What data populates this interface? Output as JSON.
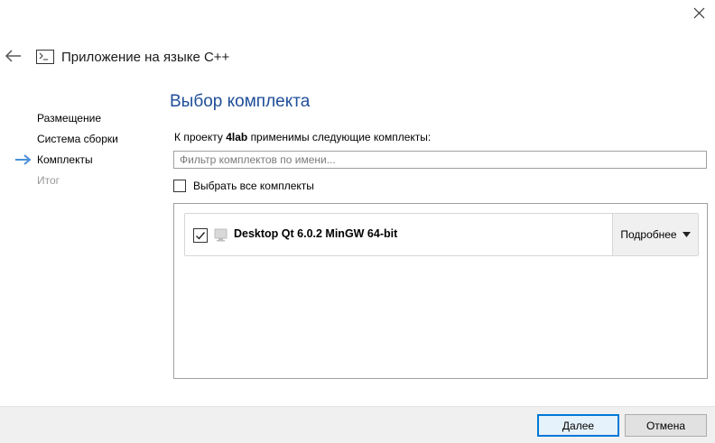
{
  "header": {
    "title": "Приложение на языке C++"
  },
  "steps": [
    {
      "label": "Размещение",
      "state": "done"
    },
    {
      "label": "Система сборки",
      "state": "done"
    },
    {
      "label": "Комплекты",
      "state": "current"
    },
    {
      "label": "Итог",
      "state": "pending"
    }
  ],
  "page": {
    "title": "Выбор комплекта",
    "intro_prefix": "К проекту",
    "project_name": "4lab",
    "intro_suffix": "применимы следующие комплекты:"
  },
  "filter": {
    "placeholder": "Фильтр комплектов по имени...",
    "value": ""
  },
  "select_all": {
    "label": "Выбрать все комплекты",
    "checked": false
  },
  "kits": [
    {
      "name": "Desktop Qt 6.0.2 MinGW 64-bit",
      "checked": true,
      "details_label": "Подробнее"
    }
  ],
  "footer": {
    "next_label": "Далее",
    "cancel_label": "Отмена"
  },
  "icons": {
    "close": "close-icon",
    "back": "back-arrow-icon",
    "project": "terminal-window-icon",
    "current_step": "right-arrow-icon",
    "kit_device": "monitor-icon",
    "dropdown": "triangle-down-icon"
  },
  "colors": {
    "accent": "#0078d7",
    "title": "#1f4e99",
    "arrow": "#4a90d9"
  }
}
